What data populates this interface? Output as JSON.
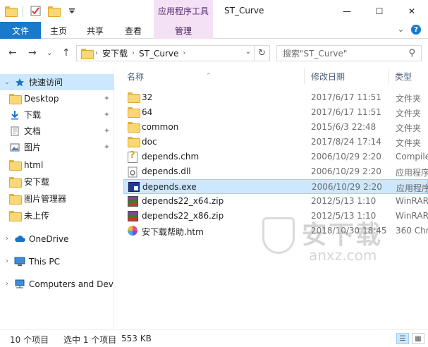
{
  "window": {
    "title": "ST_Curve",
    "context_tools": "应用程序工具",
    "minimize": "—",
    "maximize": "☐",
    "close": "✕"
  },
  "ribbon": {
    "tabs": [
      "文件",
      "主页",
      "共享",
      "查看",
      "管理"
    ],
    "collapse": "⌄"
  },
  "nav": {
    "back": "←",
    "forward": "→",
    "recent": "⌄",
    "up": "↑",
    "breadcrumb": [
      "安下载",
      "ST_Curve"
    ],
    "refresh": "↻",
    "search_placeholder": "搜索\"ST_Curve\"",
    "search_icon": "⚲"
  },
  "sidebar": {
    "items": [
      {
        "label": "快速访问",
        "icon": "star-icon"
      },
      {
        "label": "Desktop",
        "icon": "folder-icon",
        "pinned": true
      },
      {
        "label": "下载",
        "icon": "download-icon",
        "pinned": true
      },
      {
        "label": "文档",
        "icon": "document-icon",
        "pinned": true
      },
      {
        "label": "图片",
        "icon": "picture-icon",
        "pinned": true
      },
      {
        "label": "html",
        "icon": "folder-icon"
      },
      {
        "label": "安下载",
        "icon": "folder-icon"
      },
      {
        "label": "图片管理器",
        "icon": "folder-icon"
      },
      {
        "label": "未上传",
        "icon": "folder-icon"
      },
      {
        "label": "OneDrive",
        "icon": "cloud-icon"
      },
      {
        "label": "This PC",
        "icon": "computer-icon"
      },
      {
        "label": "Computers and Dev",
        "icon": "network-icon"
      }
    ],
    "pin_glyph": "📌"
  },
  "columns": {
    "name": "名称",
    "date": "修改日期",
    "type": "类型"
  },
  "files": [
    {
      "name": "32",
      "date": "2017/6/17 11:51",
      "type": "文件夹",
      "icon": "folder"
    },
    {
      "name": "64",
      "date": "2017/6/17 11:51",
      "type": "文件夹",
      "icon": "folder"
    },
    {
      "name": "common",
      "date": "2015/6/3 22:48",
      "type": "文件夹",
      "icon": "folder"
    },
    {
      "name": "doc",
      "date": "2017/8/24 17:14",
      "type": "文件夹",
      "icon": "folder"
    },
    {
      "name": "depends.chm",
      "date": "2006/10/29 2:20",
      "type": "Compile",
      "icon": "chm"
    },
    {
      "name": "depends.dll",
      "date": "2006/10/29 2:20",
      "type": "应用程序",
      "icon": "dll"
    },
    {
      "name": "depends.exe",
      "date": "2006/10/29 2:20",
      "type": "应用程序",
      "icon": "exe",
      "selected": true
    },
    {
      "name": "depends22_x64.zip",
      "date": "2012/5/13 1:10",
      "type": "WinRAR",
      "icon": "zip"
    },
    {
      "name": "depends22_x86.zip",
      "date": "2012/5/13 1:10",
      "type": "WinRAR",
      "icon": "zip"
    },
    {
      "name": "安下载帮助.htm",
      "date": "2018/10/30 18:45",
      "type": "360 Chr",
      "icon": "htm"
    }
  ],
  "watermark": {
    "text": "安下载",
    "sub": "anxz.com"
  },
  "status": {
    "count": "10 个项目",
    "selected": "选中 1 个项目",
    "size": "553 KB",
    "details_view": "☰",
    "icon_view": "▦"
  }
}
